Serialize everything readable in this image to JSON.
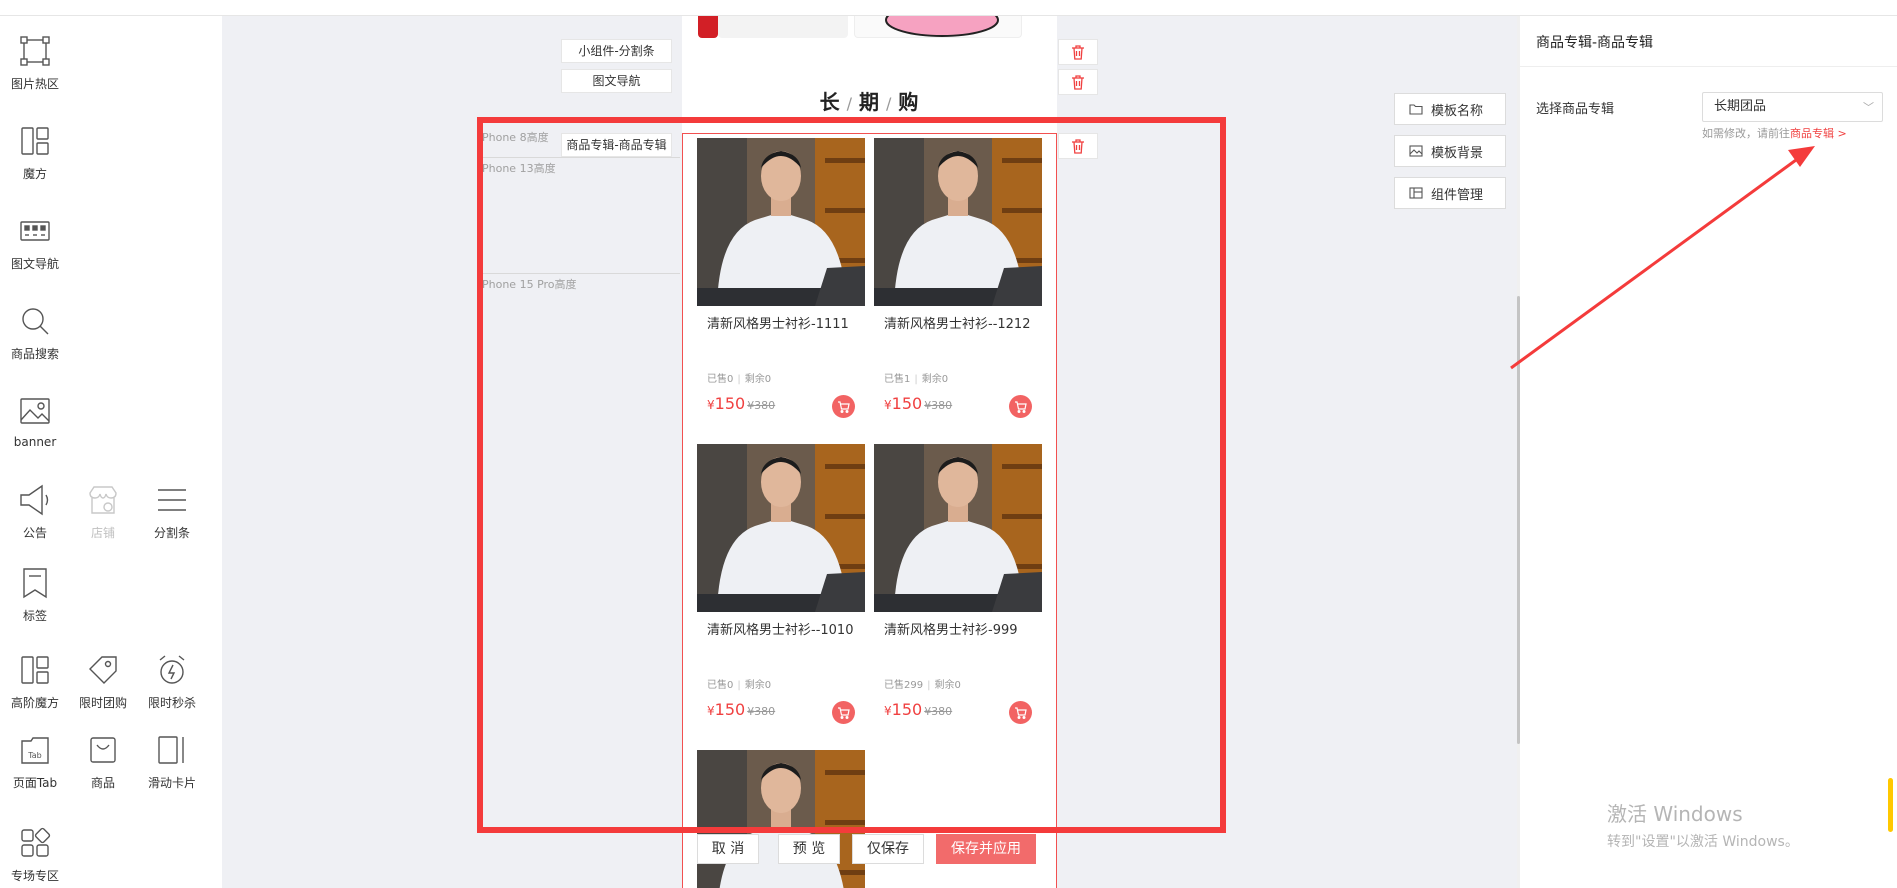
{
  "palette": {
    "items": [
      {
        "key": "hotspot",
        "label": "图片热区",
        "icon": "hotspot-icon"
      },
      {
        "key": "cube",
        "label": "魔方",
        "icon": "cube-icon"
      },
      {
        "key": "imgnav",
        "label": "图文导航",
        "icon": "image-nav-icon"
      },
      {
        "key": "search",
        "label": "商品搜索",
        "icon": "search-icon"
      },
      {
        "key": "banner",
        "label": "banner",
        "icon": "banner-icon"
      },
      {
        "key": "notice",
        "label": "公告",
        "icon": "megaphone-icon"
      },
      {
        "key": "store",
        "label": "店铺",
        "icon": "store-icon",
        "disabled": true
      },
      {
        "key": "divider",
        "label": "分割条",
        "icon": "divider-icon"
      },
      {
        "key": "tag",
        "label": "标签",
        "icon": "bookmark-icon"
      },
      {
        "key": "advcube",
        "label": "高阶魔方",
        "icon": "advanced-cube-icon"
      },
      {
        "key": "groupbuy",
        "label": "限时团购",
        "icon": "price-tag-icon"
      },
      {
        "key": "flashsale",
        "label": "限时秒杀",
        "icon": "alarm-clock-icon"
      },
      {
        "key": "pagetab",
        "label": "页面Tab",
        "icon": "page-tab-icon"
      },
      {
        "key": "goods",
        "label": "商品",
        "icon": "shopping-bag-icon"
      },
      {
        "key": "slidecard",
        "label": "滑动卡片",
        "icon": "slide-card-icon"
      },
      {
        "key": "zone",
        "label": "专场专区",
        "icon": "zone-icon"
      }
    ]
  },
  "canvas": {
    "labels": [
      "小组件-分割条",
      "图文导航",
      "商品专辑-商品专辑"
    ],
    "heights": [
      "Phone 8高度",
      "Phone 13高度",
      "Phone 15 Pro高度"
    ]
  },
  "phone": {
    "title": [
      "长",
      "期",
      "购"
    ],
    "products": [
      {
        "name": "清新风格男士衬衫-1111",
        "sold": "已售0",
        "remain": "剩余0",
        "currency": "¥",
        "price": "150",
        "original": "¥380"
      },
      {
        "name": "清新风格男士衬衫--1212",
        "sold": "已售1",
        "remain": "剩余0",
        "currency": "¥",
        "price": "150",
        "original": "¥380"
      },
      {
        "name": "清新风格男士衬衫--1010",
        "sold": "已售0",
        "remain": "剩余0",
        "currency": "¥",
        "price": "150",
        "original": "¥380"
      },
      {
        "name": "清新风格男士衬衫-999",
        "sold": "已售299",
        "remain": "剩余0",
        "currency": "¥",
        "price": "150",
        "original": "¥380"
      }
    ]
  },
  "actions": {
    "cancel": "取 消",
    "preview": "预 览",
    "save_only": "仅保存",
    "save_apply": "保存并应用"
  },
  "tools": {
    "template_name": "模板名称",
    "template_bg": "模板背景",
    "component_mgmt": "组件管理"
  },
  "panel": {
    "title": "商品专辑-商品专辑",
    "field_label": "选择商品专辑",
    "selected_album": "长期团品",
    "hint_prefix": "如需修改，请前往",
    "hint_link": "商品专辑 >"
  },
  "watermark": {
    "line1": "激活 Windows",
    "line2": "转到\"设置\"以激活 Windows。"
  },
  "colors": {
    "accent": "#f04040",
    "highlight_border": "#f43b3b",
    "cart": "#f26363",
    "primary_button": "#f26b6b"
  }
}
